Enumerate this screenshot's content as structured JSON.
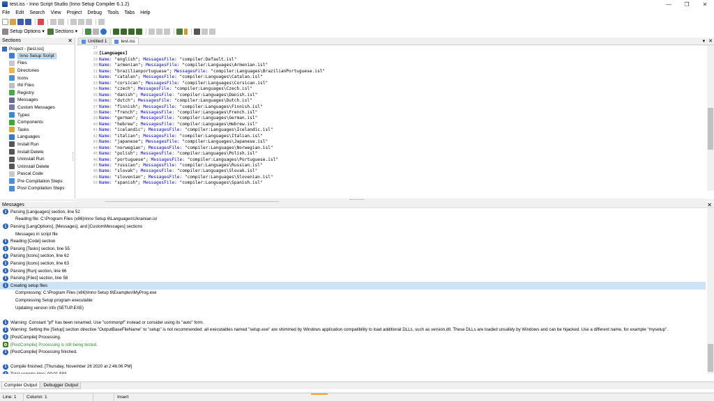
{
  "window": {
    "title": "test.iss - Inno Script Studio (Inno Setup Compiler 6.1.2)",
    "controls": [
      "—",
      "❐",
      "✕"
    ]
  },
  "menu": [
    "File",
    "Edit",
    "Search",
    "View",
    "Project",
    "Debug",
    "Tools",
    "Tabs",
    "Help"
  ],
  "toolbar": {
    "setup_options_label": "Setup Options",
    "sections_label": "Sections"
  },
  "sections_panel": {
    "title": "Sections",
    "close": "✕",
    "root": "Project - [test.iss]",
    "items": [
      {
        "label": "Inno Setup Script",
        "color": "#3b7dd8",
        "selected": true
      },
      {
        "label": "Files",
        "color": "#c8c8c8"
      },
      {
        "label": "Directories",
        "color": "#e8b84a"
      },
      {
        "label": "Icons",
        "color": "#4a8fd8"
      },
      {
        "label": "INI Files",
        "color": "#bfbfbf"
      },
      {
        "label": "Registry",
        "color": "#4aa84a"
      },
      {
        "label": "Messages",
        "color": "#6a6a9a"
      },
      {
        "label": "Custom Messages",
        "color": "#7a7aa8"
      },
      {
        "label": "Types",
        "color": "#3a8ad8"
      },
      {
        "label": "Components",
        "color": "#3aa83a"
      },
      {
        "label": "Tasks",
        "color": "#d8a83a"
      },
      {
        "label": "Languages",
        "color": "#3a78c8"
      },
      {
        "label": "Install Run",
        "color": "#555555"
      },
      {
        "label": "Install Delete",
        "color": "#555555"
      },
      {
        "label": "Uninstall Run",
        "color": "#555555"
      },
      {
        "label": "Uninstall Delete",
        "color": "#555555"
      },
      {
        "label": "Pascal Code",
        "color": "#c8c8c8"
      },
      {
        "label": "Pre Compilation Steps",
        "color": "#4a8fd8"
      },
      {
        "label": "Post Compilation Steps",
        "color": "#4a8fd8"
      }
    ]
  },
  "editor": {
    "tabs": [
      {
        "label": "Untitled 1",
        "active": false
      },
      {
        "label": "test.iss",
        "active": true
      }
    ],
    "tab_controls": [
      "▾",
      "✕"
    ],
    "lines": [
      {
        "n": "27",
        "section": ""
      },
      {
        "n": "28",
        "section": "[Languages]"
      },
      {
        "n": "29",
        "name": "\"english\"",
        "file": "\"compiler:Default.isl\""
      },
      {
        "n": "30",
        "name": "\"armenian\"",
        "file": "\"compiler:Languages\\Armenian.isl\""
      },
      {
        "n": "31",
        "name": "\"brazilianportuguese\"",
        "file": "\"compiler:Languages\\BrazilianPortuguese.isl\""
      },
      {
        "n": "32",
        "name": "\"catalan\"",
        "file": "\"compiler:Languages\\Catalan.isl\""
      },
      {
        "n": "33",
        "name": "\"corsican\"",
        "file": "\"compiler:Languages\\Corsican.isl\""
      },
      {
        "n": "34",
        "name": "\"czech\"",
        "file": "\"compiler:Languages\\Czech.isl\""
      },
      {
        "n": "35",
        "name": "\"danish\"",
        "file": "\"compiler:Languages\\Danish.isl\""
      },
      {
        "n": "36",
        "name": "\"dutch\"",
        "file": "\"compiler:Languages\\Dutch.isl\""
      },
      {
        "n": "37",
        "name": "\"finnish\"",
        "file": "\"compiler:Languages\\Finnish.isl\""
      },
      {
        "n": "38",
        "name": "\"french\"",
        "file": "\"compiler:Languages\\French.isl\""
      },
      {
        "n": "39",
        "name": "\"german\"",
        "file": "\"compiler:Languages\\German.isl\""
      },
      {
        "n": "40",
        "name": "\"hebrew\"",
        "file": "\"compiler:Languages\\Hebrew.isl\""
      },
      {
        "n": "41",
        "name": "\"icelandic\"",
        "file": "\"compiler:Languages\\Icelandic.isl\""
      },
      {
        "n": "42",
        "name": "\"italian\"",
        "file": "\"compiler:Languages\\Italian.isl\""
      },
      {
        "n": "43",
        "name": "\"japanese\"",
        "file": "\"compiler:Languages\\Japanese.isl\""
      },
      {
        "n": "44",
        "name": "\"norwegian\"",
        "file": "\"compiler:Languages\\Norwegian.isl\""
      },
      {
        "n": "45",
        "name": "\"polish\"",
        "file": "\"compiler:Languages\\Polish.isl\""
      },
      {
        "n": "46",
        "name": "\"portuguese\"",
        "file": "\"compiler:Languages\\Portuguese.isl\""
      },
      {
        "n": "47",
        "name": "\"russian\"",
        "file": "\"compiler:Languages\\Russian.isl\""
      },
      {
        "n": "48",
        "name": "\"slovak\"",
        "file": "\"compiler:Languages\\Slovak.isl\""
      },
      {
        "n": "49",
        "name": "\"slovenian\"",
        "file": "\"compiler:Languages\\Slovenian.isl\""
      },
      {
        "n": "50",
        "name": "\"spanish\"",
        "file": "\"compiler:Languages\\Spanish.isl\""
      }
    ],
    "kw_name": "Name:",
    "kw_file": "MessagesFile:"
  },
  "messages_panel": {
    "title": "Messages",
    "close": "✕",
    "items": [
      {
        "text": "Parsing [Languages] section, line 52",
        "icon": "i"
      },
      {
        "text": "Reading file: C:\\Program Files (x86)\\Inno Setup 6\\Languages\\Ukrainian.isl",
        "indent": true
      },
      {
        "text": "Parsing [LangOptions], [Messages], and [CustomMessages] sections",
        "icon": "i"
      },
      {
        "text": "Messages in script file",
        "indent": true
      },
      {
        "text": "Reading [Code] section",
        "icon": "i"
      },
      {
        "text": "Parsing [Tasks] section, line 55",
        "icon": "i"
      },
      {
        "text": "Parsing [Icons] section, line 62",
        "icon": "i"
      },
      {
        "text": "Parsing [Icons] section, line 63",
        "icon": "i"
      },
      {
        "text": "Parsing [Run] section, line 66",
        "icon": "i"
      },
      {
        "text": "Parsing [Files] section, line 58",
        "icon": "i"
      },
      {
        "text": "Creating setup files",
        "icon": "i",
        "highlight": true
      },
      {
        "text": "Compressing: C:\\Program Files (x86)\\Inno Setup 6\\Examples\\MyProg.exe",
        "indent": true
      },
      {
        "text": "Compressing Setup program executable",
        "indent": true
      },
      {
        "text": "Updating version info (SETUP.EXE)",
        "indent": true
      },
      {
        "text": "",
        "blank": true
      },
      {
        "text": "Warning: Constant \"pf\" has been renamed. Use \"commonpf\" instead or consider using its \"auto\" form.",
        "icon": "i"
      },
      {
        "text": "Warning: Setting the [Setup] section directive \"OutputBaseFileName\" to \"setup\" is not recommended: all executables named \"setup.exe\" are shimmed by Windows application compatibility to load additional DLLs, such as version.dll. These DLLs are loaded unsafely by Windows and can be hijacked. Use a different name, for example \"mysetup\".",
        "icon": "i"
      },
      {
        "text": "[PostCompile] Processing.",
        "icon": "i"
      },
      {
        "text": "[PostCompile] Processing is still being tested.",
        "icon": "gear",
        "green": true
      },
      {
        "text": "[PostCompile] Processing finished.",
        "icon": "i"
      },
      {
        "text": "",
        "blank": true
      },
      {
        "text": "Compile finished.  [Thursday, November 26 2020 at 2:46:06 PM]",
        "icon": "i"
      },
      {
        "text": "Total compile time: 00:01.593",
        "icon": "i"
      }
    ]
  },
  "bottom_tabs": [
    {
      "label": "Compiler Output",
      "active": true
    },
    {
      "label": "Debugger Output",
      "active": false
    }
  ],
  "status": {
    "line": "Line: 1",
    "column": "Column: 1",
    "mode": "Insert"
  }
}
